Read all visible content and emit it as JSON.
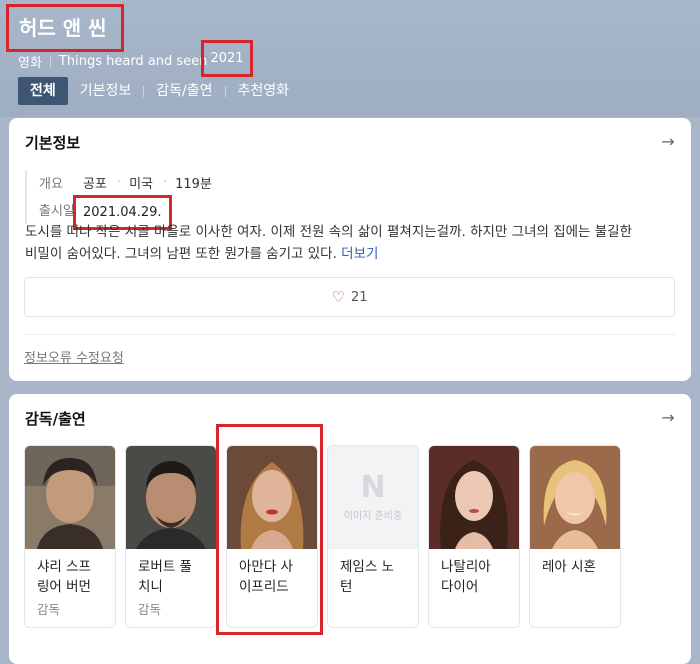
{
  "header": {
    "title": "허드 앤 씬",
    "category": "영화",
    "original_title": "Things heard and seen",
    "year": "2021"
  },
  "tabs": [
    "전체",
    "기본정보",
    "감독/출연",
    "추천영화"
  ],
  "basic_info": {
    "section_title": "기본정보",
    "overview_label": "개요",
    "genre": "공포",
    "country": "미국",
    "runtime": "119분",
    "release_label": "출시일",
    "release_date": "2021.04.29.",
    "description_line1": "도시를 떠나 작은 시골 마을로 이사한 여자. 이제 전원 속의 삶이 펼쳐지는걸까. 하지만 그녀의 집에는 불길한",
    "description_line2": "비밀이 숨어있다. 그녀의 남편 또한 뭔가를 숨기고 있다.",
    "more_label": "더보기",
    "like_count": "21",
    "report_label": "정보오류 수정요청"
  },
  "cast": {
    "section_title": "감독/출연",
    "people": [
      {
        "name": "샤리 스프링어 버먼",
        "line1": "샤리 스프",
        "line2": "링어 버먼",
        "role": "감독"
      },
      {
        "name": "로버트 풀치니",
        "line1": "로버트 풀",
        "line2": "치니",
        "role": "감독"
      },
      {
        "name": "아만다 사이프리드",
        "line1": "아만다 사",
        "line2": "이프리드",
        "role": ""
      },
      {
        "name": "제임스 노턴",
        "line1": "제임스 노",
        "line2": "턴",
        "role": ""
      },
      {
        "name": "나탈리아 다이어",
        "line1": "나탈리아",
        "line2": "다이어",
        "role": ""
      },
      {
        "name": "레아 시혼",
        "line1": "레아 시혼",
        "line2": "",
        "role": ""
      }
    ],
    "no_image_label": "이미지 준비중",
    "no_image_logo": "N"
  },
  "colors": {
    "header_bg": "#a9b6c9",
    "active_tab": "#3e5573",
    "highlight": "#d8242c",
    "link": "#2f5fb8"
  }
}
